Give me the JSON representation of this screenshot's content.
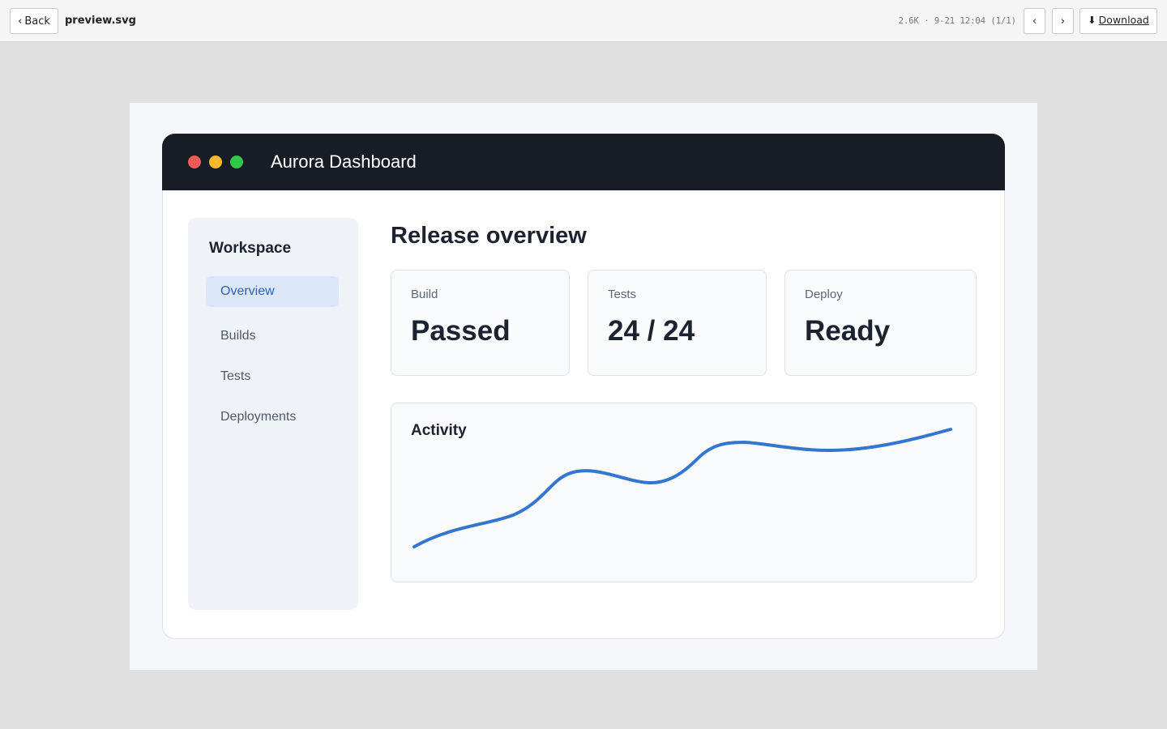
{
  "toolbar": {
    "back_label": "Back",
    "back_icon": "chevron-left-icon",
    "file_name": "preview.svg",
    "file_meta": "2.6K · 9-21 12:04 (1/1)",
    "prev_icon": "chevron-left-icon",
    "next_icon": "chevron-right-icon",
    "download_label": "Download",
    "download_icon": "download-icon"
  },
  "window": {
    "title": "Aurora Dashboard",
    "controls": [
      {
        "name": "close",
        "color": "#ed5c57"
      },
      {
        "name": "minimize",
        "color": "#f5b82a"
      },
      {
        "name": "maximize",
        "color": "#33c748"
      }
    ]
  },
  "sidebar": {
    "heading": "Workspace",
    "items": [
      {
        "label": "Overview",
        "active": true
      },
      {
        "label": "Builds",
        "active": false
      },
      {
        "label": "Tests",
        "active": false
      },
      {
        "label": "Deployments",
        "active": false
      }
    ]
  },
  "main": {
    "title": "Release overview",
    "stats": [
      {
        "label": "Build",
        "value": "Passed"
      },
      {
        "label": "Tests",
        "value": "24 / 24"
      },
      {
        "label": "Deploy",
        "value": "Ready"
      }
    ],
    "activity": {
      "title": "Activity",
      "line_color": "#3476cf"
    }
  },
  "colors": {
    "accent": "#2b63b8",
    "titlebar": "#181d25",
    "page_bg": "#e0e0e0"
  }
}
